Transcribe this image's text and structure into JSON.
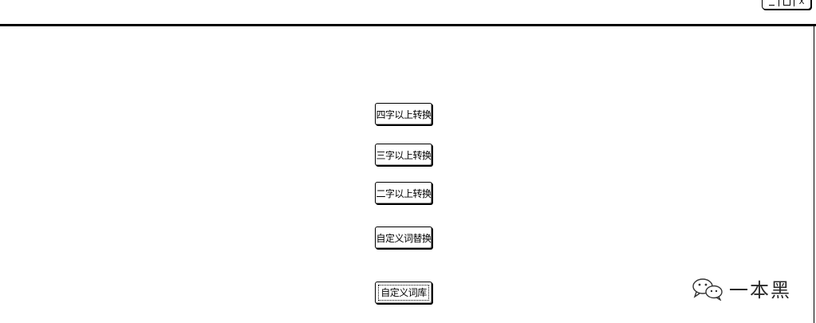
{
  "window": {
    "controls": {
      "minimize_icon": "minimize-icon",
      "maximize_icon": "maximize-icon",
      "close_glyph": "X"
    }
  },
  "buttons": [
    {
      "label": "四字以上转换"
    },
    {
      "label": "三字以上转换"
    },
    {
      "label": "二字以上转换"
    },
    {
      "label": "自定义词替换"
    },
    {
      "label": "自定义词库"
    }
  ],
  "watermark": {
    "icon": "wechat-icon",
    "text": "一本黑"
  }
}
